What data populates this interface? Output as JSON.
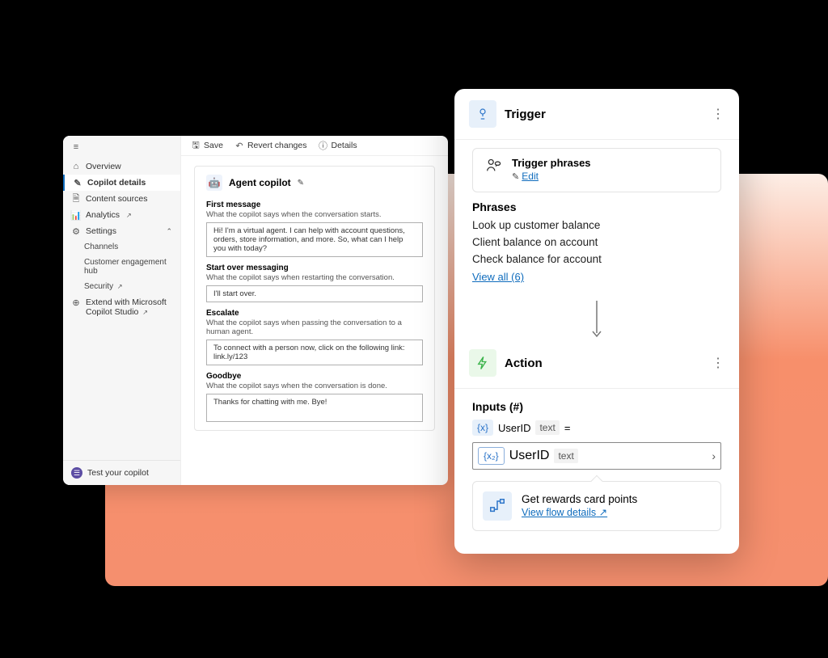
{
  "sidebar": {
    "items": [
      {
        "label": "Overview"
      },
      {
        "label": "Copilot details"
      },
      {
        "label": "Content sources"
      },
      {
        "label": "Analytics"
      },
      {
        "label": "Settings"
      }
    ],
    "settings_children": [
      {
        "label": "Channels"
      },
      {
        "label": "Customer engagement hub"
      },
      {
        "label": "Security"
      }
    ],
    "extend": {
      "line1": "Extend with Microsoft",
      "line2": "Copilot Studio"
    },
    "test_label": "Test your copilot"
  },
  "toolbar": {
    "save": "Save",
    "revert": "Revert changes",
    "details": "Details"
  },
  "agent": {
    "title": "Agent copilot",
    "fields": [
      {
        "label": "First message",
        "desc": "What the copilot says when the conversation starts.",
        "value": "Hi! I'm a virtual agent. I can help with account questions, orders, store information, and more. So, what can I help you with today?"
      },
      {
        "label": "Start over messaging",
        "desc": "What the copilot says when restarting the conversation.",
        "value": "I'll start over."
      },
      {
        "label": "Escalate",
        "desc": "What the copilot says when passing the conversation to a human agent.",
        "value": "To connect with a person now, click on the following link: link.ly/123"
      },
      {
        "label": "Goodbye",
        "desc": "What the copilot says when the conversation is done.",
        "value": "Thanks for chatting with me. Bye!"
      }
    ]
  },
  "popup": {
    "trigger_title": "Trigger",
    "trigger_sub_title": "Trigger phrases",
    "trigger_sub_link": "Edit",
    "phrases_label": "Phrases",
    "phrases": [
      "Look up customer balance",
      "Client balance on account",
      "Check balance for account"
    ],
    "viewall": "View all  (6)",
    "action_title": "Action",
    "inputs_label": "Inputs (#)",
    "chip_x": "{x}",
    "chip_x2": "{x₂}",
    "userid": "UserID",
    "text": "text",
    "eq": "=",
    "flow_title": "Get rewards card points",
    "flow_link": "View flow details"
  }
}
